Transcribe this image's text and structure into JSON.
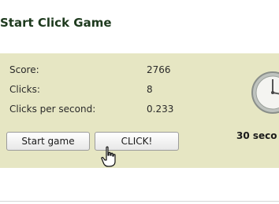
{
  "title": "Start Click Game",
  "stats": [
    {
      "label": "Score:",
      "value": "2766"
    },
    {
      "label": "Clicks:",
      "value": "8"
    },
    {
      "label": "Clicks per second:",
      "value": "0.233"
    }
  ],
  "buttons": {
    "start": "Start game",
    "click": "CLICK!"
  },
  "timer": "30 seco",
  "icons": {
    "clock": "clock-icon",
    "cursor": "hand-pointer-icon"
  },
  "colors": {
    "panel": "#e6e6c3",
    "title": "#1e3a1e"
  }
}
